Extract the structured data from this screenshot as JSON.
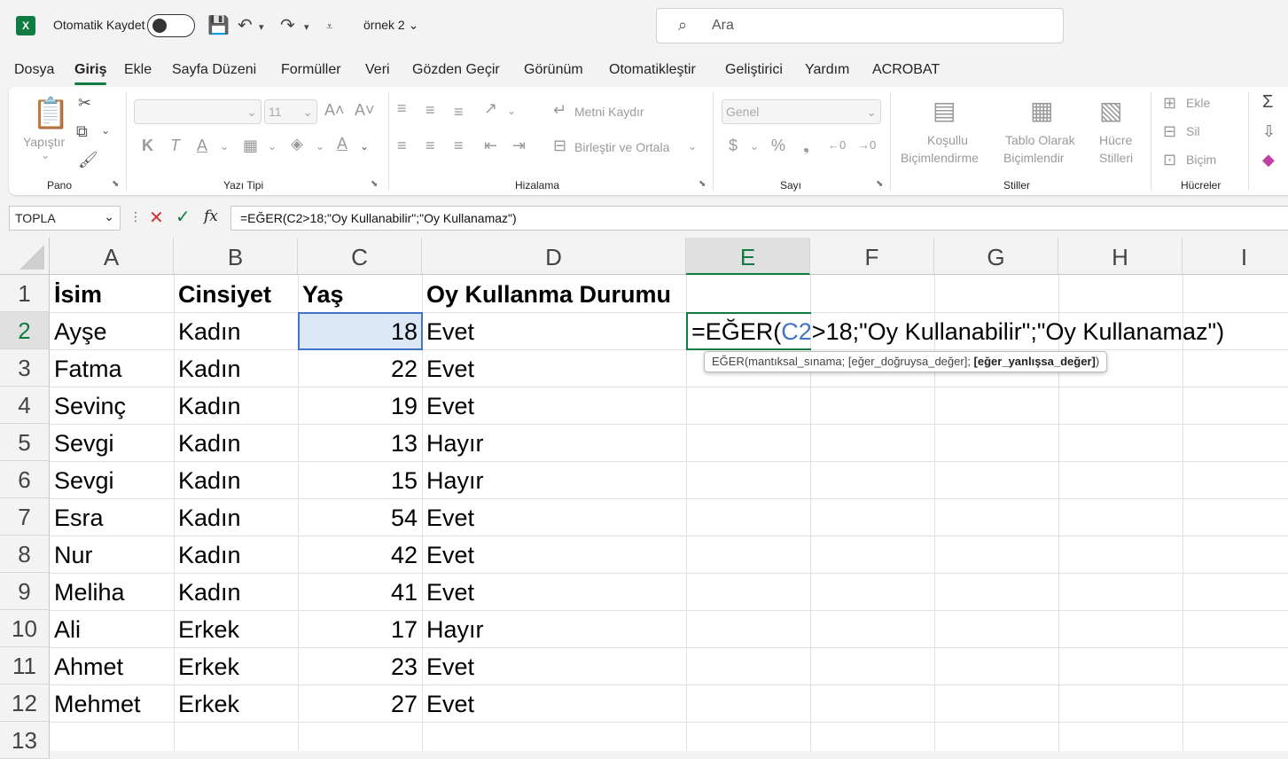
{
  "titlebar": {
    "logo": "X",
    "autosave_label": "Otomatik Kaydet",
    "doc_name": "örnek 2",
    "search_placeholder": "Ara"
  },
  "menu": [
    "Dosya",
    "Giriş",
    "Ekle",
    "Sayfa Düzeni",
    "Formüller",
    "Veri",
    "Gözden Geçir",
    "Görünüm",
    "Otomatikleştir",
    "Geliştirici",
    "Yardım",
    "ACROBAT"
  ],
  "ribbon": {
    "pano": {
      "label": "Pano",
      "paste": "Yapıştır"
    },
    "font": {
      "label": "Yazı Tipi",
      "font_name": "",
      "font_size": "11",
      "bold": "K",
      "italic": "T",
      "underline": "A"
    },
    "align": {
      "label": "Hizalama",
      "wrap": "Metni Kaydır",
      "merge": "Birleştir ve Ortala"
    },
    "number": {
      "label": "Sayı",
      "format": "Genel",
      "currency": "$",
      "percent": "%",
      "comma": "❟"
    },
    "styles": {
      "label": "Stiller",
      "cond1": "Koşullu",
      "cond2": "Biçimlendirme",
      "table1": "Tablo Olarak",
      "table2": "Biçimlendir",
      "cell1": "Hücre",
      "cell2": "Stilleri"
    },
    "cells": {
      "label": "Hücreler",
      "insert": "Ekle",
      "delete": "Sil",
      "format": "Biçim"
    }
  },
  "formula_bar": {
    "name_box": "TOPLA",
    "formula": "=EĞER(C2>18;\"Oy Kullanabilir\";\"Oy Kullanamaz\")"
  },
  "columns": [
    "A",
    "B",
    "C",
    "D",
    "E",
    "F",
    "G",
    "H",
    "I"
  ],
  "rows": [
    "1",
    "2",
    "3",
    "4",
    "5",
    "6",
    "7",
    "8",
    "9",
    "10",
    "11",
    "12",
    "13"
  ],
  "headers": {
    "a": "İsim",
    "b": "Cinsiyet",
    "c": "Yaş",
    "d": "Oy Kullanma Durumu"
  },
  "data": [
    {
      "name": "Ayşe",
      "gender": "Kadın",
      "age": "18",
      "status": "Evet"
    },
    {
      "name": "Fatma",
      "gender": "Kadın",
      "age": "22",
      "status": "Evet"
    },
    {
      "name": "Sevinç",
      "gender": "Kadın",
      "age": "19",
      "status": "Evet"
    },
    {
      "name": "Sevgi",
      "gender": "Kadın",
      "age": "13",
      "status": "Hayır"
    },
    {
      "name": "Sevgi",
      "gender": "Kadın",
      "age": "15",
      "status": "Hayır"
    },
    {
      "name": "Esra",
      "gender": "Kadın",
      "age": "54",
      "status": "Evet"
    },
    {
      "name": "Nur",
      "gender": "Kadın",
      "age": "42",
      "status": "Evet"
    },
    {
      "name": "Meliha",
      "gender": "Kadın",
      "age": "41",
      "status": "Evet"
    },
    {
      "name": "Ali",
      "gender": "Erkek",
      "age": "17",
      "status": "Hayır"
    },
    {
      "name": "Ahmet",
      "gender": "Erkek",
      "age": "23",
      "status": "Evet"
    },
    {
      "name": "Mehmet",
      "gender": "Erkek",
      "age": "27",
      "status": "Evet"
    }
  ],
  "editing": {
    "prefix": "=EĞER(",
    "ref": "C2",
    "suffix": ">18;\"Oy Kullanabilir\";\"Oy Kullanamaz\")",
    "tooltip_a": "EĞER(mantıksal_sınama; [eğer_doğruysa_değer]; ",
    "tooltip_b": "[eğer_yanlışsa_değer]",
    "tooltip_c": ")"
  },
  "colors": {
    "accent": "#107c41",
    "selection": "#4472c4",
    "ref": "#4472c4"
  }
}
